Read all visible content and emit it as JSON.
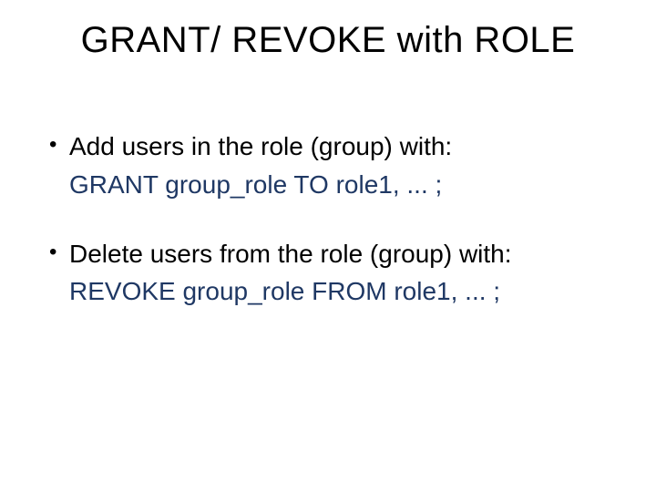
{
  "title": "GRANT/ REVOKE with ROLE",
  "items": [
    {
      "bullet": "Add users in the role (group) with:",
      "code": "GRANT group_role TO role1, ... ;"
    },
    {
      "bullet": "Delete users from the role (group) with:",
      "code": "REVOKE group_role FROM role1, ... ;"
    }
  ],
  "colors": {
    "code": "#1f3864",
    "text": "#000000",
    "background": "#ffffff"
  }
}
